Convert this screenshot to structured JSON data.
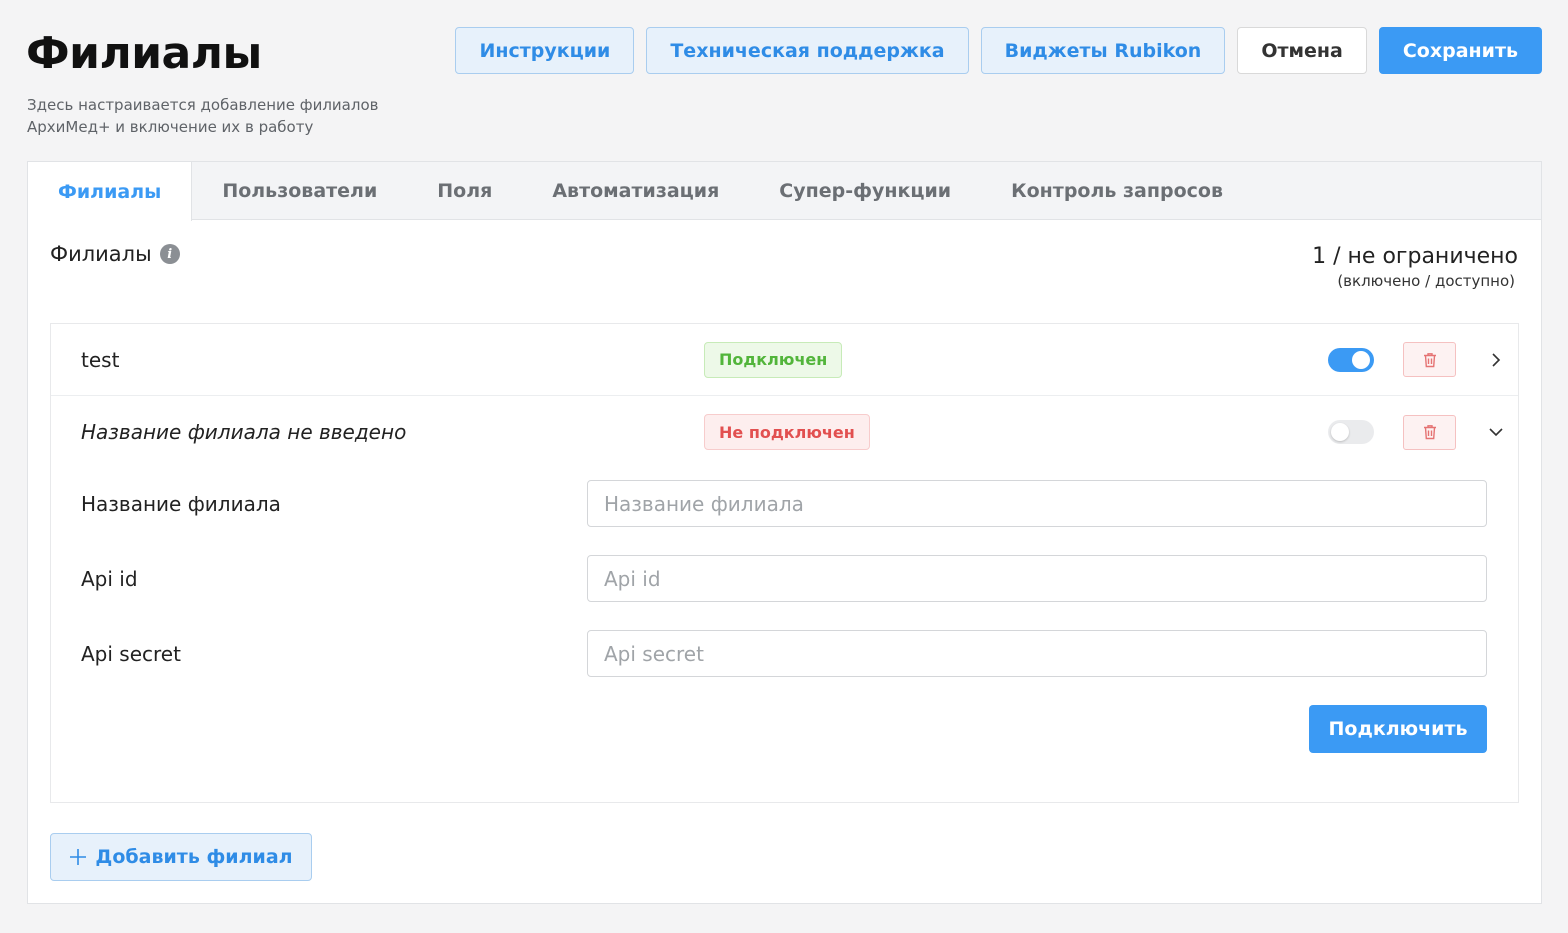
{
  "header": {
    "title": "Филиалы",
    "subtitle": "Здесь настраивается добавление филиалов АрхиМед+ и включение их в работу",
    "buttons": {
      "instructions": "Инструкции",
      "support": "Техническая поддержка",
      "widgets": "Виджеты Rubikon",
      "cancel": "Отмена",
      "save": "Сохранить"
    }
  },
  "tabs": [
    {
      "label": "Филиалы",
      "active": true
    },
    {
      "label": "Пользователи",
      "active": false
    },
    {
      "label": "Поля",
      "active": false
    },
    {
      "label": "Автоматизация",
      "active": false
    },
    {
      "label": "Супер-функции",
      "active": false
    },
    {
      "label": "Контроль запросов",
      "active": false
    }
  ],
  "section": {
    "title": "Филиалы",
    "counter_value": "1 / не ограничено",
    "counter_hint": "(включено / доступно)"
  },
  "branches": [
    {
      "name": "test",
      "status": "Подключен",
      "enabled": true,
      "expanded": false
    },
    {
      "name": "Название филиала не введено",
      "status": "Не подключен",
      "enabled": false,
      "expanded": true,
      "form": {
        "name_label": "Название филиала",
        "name_placeholder": "Название филиала",
        "api_id_label": "Api id",
        "api_id_placeholder": "Api id",
        "api_secret_label": "Api secret",
        "api_secret_placeholder": "Api secret",
        "connect_button": "Подключить"
      }
    }
  ],
  "add_branch_button": "Добавить филиал",
  "colors": {
    "accent": "#3b9af4",
    "success": "#52b53b",
    "danger": "#e25050"
  },
  "icons": {
    "info": "info-icon",
    "trash": "trash-icon",
    "chevron_right": "chevron-right-icon",
    "chevron_down": "chevron-down-icon",
    "plus": "plus-icon"
  }
}
